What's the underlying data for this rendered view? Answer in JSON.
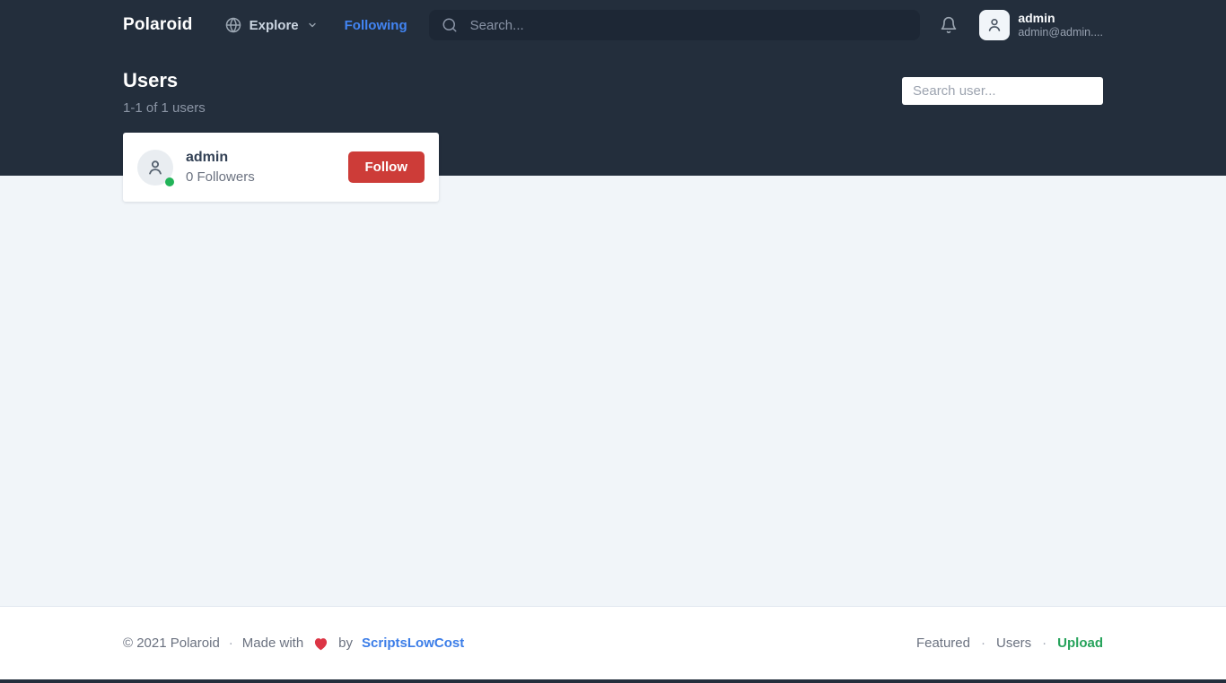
{
  "navbar": {
    "brand": "Polaroid",
    "explore_label": "Explore",
    "following_label": "Following",
    "search_placeholder": "Search...",
    "user": {
      "name": "admin",
      "email": "admin@admin...."
    }
  },
  "page": {
    "title": "Users",
    "subtitle": "1-1 of 1 users",
    "search_placeholder": "Search user..."
  },
  "users": [
    {
      "name": "admin",
      "followers": "0 Followers",
      "action_label": "Follow",
      "online": true
    }
  ],
  "footer": {
    "copyright": "© 2021 Polaroid",
    "separator": "·",
    "made_with": "Made with",
    "by": "by",
    "credit": "ScriptsLowCost",
    "links": [
      {
        "label": "Featured"
      },
      {
        "label": "Users"
      },
      {
        "label": "Upload"
      }
    ]
  },
  "icons": {
    "globe": "globe-icon",
    "chevron": "chevron-down-icon",
    "search": "search-icon",
    "bell": "bell-icon",
    "user": "user-icon",
    "heart": "heart-icon",
    "online": "online-status-dot"
  },
  "colors": {
    "header_bg": "#232e3c",
    "navbar_search_bg": "#1d2735",
    "accent_blue": "#4285f4",
    "follow_red": "#cd3c38",
    "online_green": "#22b358",
    "upload_green": "#27a35c",
    "heart_red": "#dc3545",
    "content_bg": "#f1f5f9"
  }
}
